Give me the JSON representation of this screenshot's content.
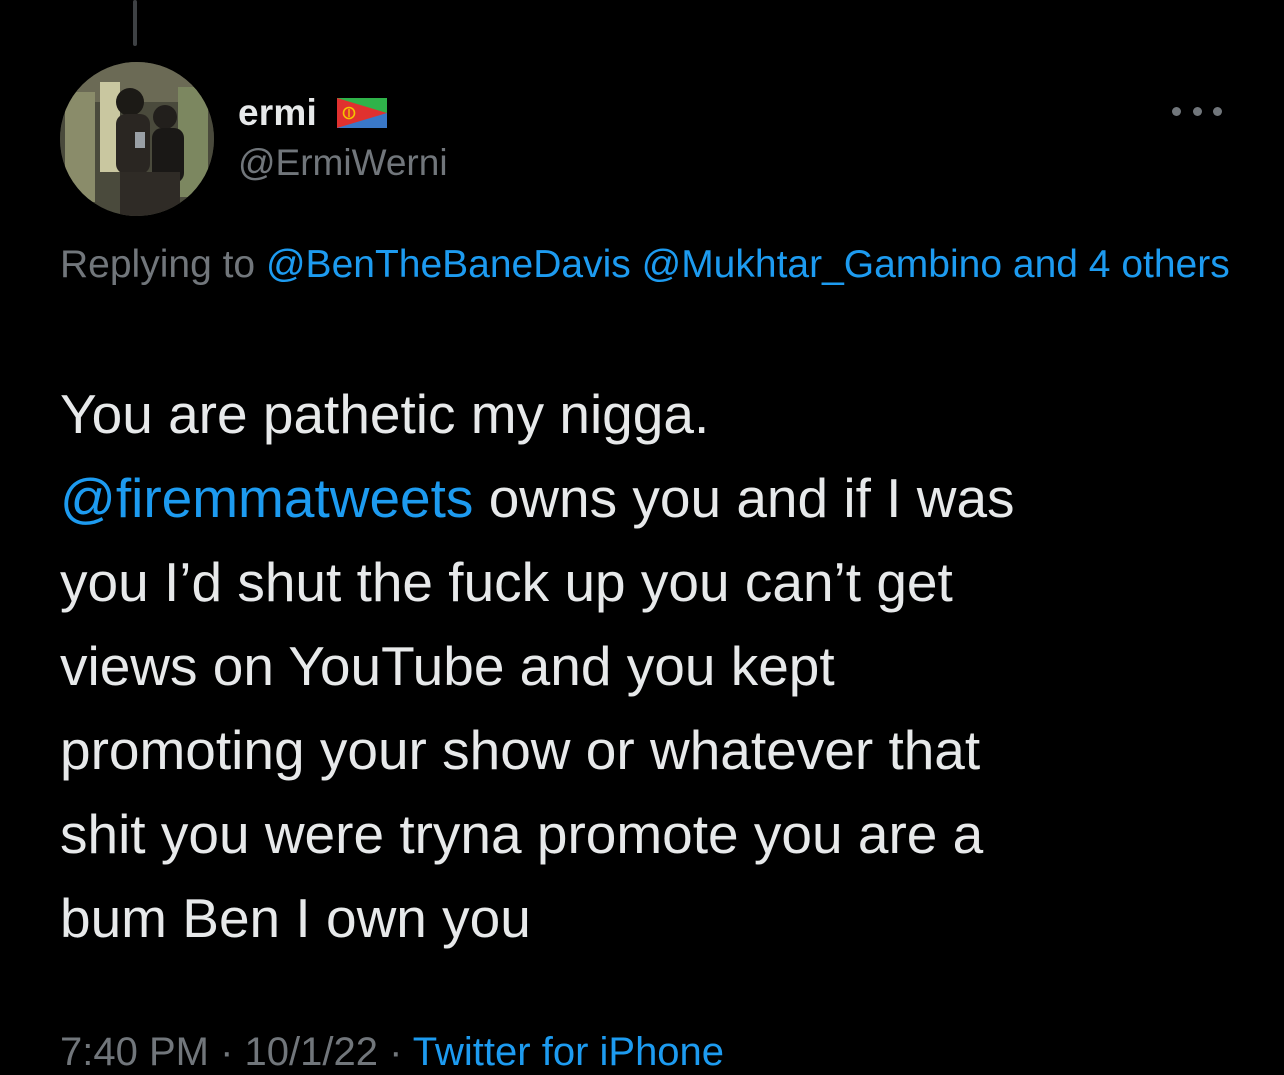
{
  "tweet": {
    "author": {
      "display_name": "ermi",
      "handle": "@ErmiWerni",
      "flag_icon": "eritrea-flag-icon",
      "avatar_icon": "profile-photo-avatar"
    },
    "more_icon": "more-options-icon",
    "replying": {
      "prefix": "Replying to",
      "mention_1": "@BenTheBaneDavis",
      "mention_2": "@Mukhtar_Gambino",
      "and_word": "and",
      "others": "4 others"
    },
    "body": {
      "line_1": "You are pathetic my nigga.",
      "mention": "@firemmatweets",
      "line_2_rest": " owns you and if I was",
      "line_3": "you I’d shut the fuck up you can’t get",
      "line_4": "views on YouTube and you kept",
      "line_5": "promoting your show or whatever that",
      "line_6": "shit you were tryna promote you are a",
      "line_7": "bum Ben I own you"
    },
    "meta": {
      "time": "7:40 PM · 10/1/22 · ",
      "source": "Twitter for iPhone"
    }
  },
  "colors": {
    "background": "#000000",
    "text": "#e7e9ea",
    "secondary": "#71767b",
    "accent": "#1d9bf0",
    "thread_line": "#3e4144"
  }
}
